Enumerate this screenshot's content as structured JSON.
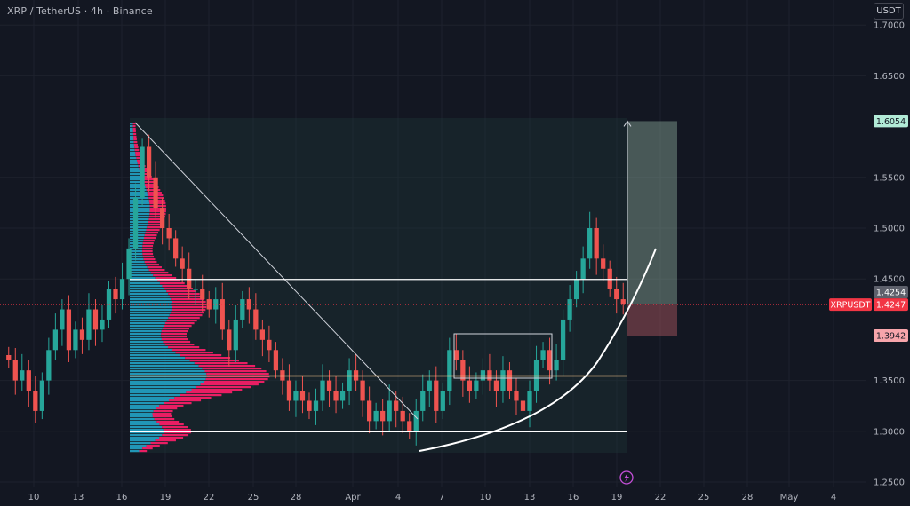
{
  "header": {
    "symbol_title": "XRP / TetherUS · 4h · Binance",
    "currency_button": "USDT"
  },
  "price_axis": {
    "ticks": [
      "1.7000",
      "1.6500",
      "1.6054",
      "1.5500",
      "1.5000",
      "1.4500",
      "1.4254",
      "1.4247",
      "1.3942",
      "1.3500",
      "1.3000",
      "1.2500"
    ],
    "tick_values": [
      1.7,
      1.65,
      1.55,
      1.5,
      1.45,
      1.35,
      1.3,
      1.25
    ],
    "tick_labels": [
      "1.7000",
      "1.6500",
      "1.5500",
      "1.5000",
      "1.4500",
      "1.3500",
      "1.3000",
      "1.2500"
    ]
  },
  "price_tags": {
    "target": {
      "label": "1.6054",
      "bg": "#b2ebd7",
      "fg": "#131722"
    },
    "last_close": {
      "label": "1.4254",
      "bg": "#5d606b",
      "fg": "#ffffff"
    },
    "symbol": {
      "label": "XRPUSDT",
      "bg": "#f23645",
      "fg": "#ffffff"
    },
    "current": {
      "label": "1.4247",
      "bg": "#f23645",
      "fg": "#ffffff"
    },
    "stop": {
      "label": "1.3942",
      "bg": "#f7a5ab",
      "fg": "#131722"
    }
  },
  "time_axis": {
    "labels": [
      "10",
      "13",
      "16",
      "19",
      "22",
      "25",
      "28",
      "Apr",
      "4",
      "7",
      "10",
      "13",
      "16",
      "19",
      "22",
      "25",
      "28",
      "May",
      "4"
    ]
  },
  "colors": {
    "background": "#131722",
    "up_candle": "#26a69a",
    "down_candle": "#ef5350",
    "volume_profile_up": "#2196b6",
    "volume_profile_down": "#e91e63",
    "grid": "#1e222d",
    "poc_line": "#f5c48a",
    "level_line": "#ffffff",
    "current_price_line": "#f23645"
  },
  "chart_data": {
    "type": "candlestick",
    "symbol": "XRPUSDT",
    "interval": "4h",
    "exchange": "Binance",
    "y_range": [
      1.245,
      1.72
    ],
    "current_price": 1.4247,
    "horizontal_levels": [
      1.4495,
      1.3545,
      1.2995
    ],
    "position": {
      "entry": 1.4247,
      "target": 1.6054,
      "stop": 1.3942
    },
    "close_path": [
      1.37,
      1.35,
      1.36,
      1.34,
      1.32,
      1.35,
      1.38,
      1.4,
      1.42,
      1.38,
      1.4,
      1.39,
      1.42,
      1.4,
      1.41,
      1.44,
      1.43,
      1.45,
      1.48,
      1.53,
      1.58,
      1.55,
      1.52,
      1.5,
      1.49,
      1.47,
      1.46,
      1.44,
      1.44,
      1.43,
      1.42,
      1.43,
      1.4,
      1.38,
      1.41,
      1.43,
      1.42,
      1.4,
      1.39,
      1.38,
      1.36,
      1.35,
      1.33,
      1.34,
      1.33,
      1.32,
      1.33,
      1.35,
      1.34,
      1.33,
      1.34,
      1.36,
      1.35,
      1.33,
      1.31,
      1.32,
      1.31,
      1.33,
      1.32,
      1.31,
      1.3,
      1.32,
      1.34,
      1.35,
      1.32,
      1.34,
      1.38,
      1.37,
      1.35,
      1.34,
      1.35,
      1.36,
      1.35,
      1.34,
      1.36,
      1.34,
      1.33,
      1.32,
      1.34,
      1.37,
      1.38,
      1.36,
      1.37,
      1.41,
      1.43,
      1.45,
      1.47,
      1.5,
      1.47,
      1.46,
      1.44,
      1.43,
      1.425
    ]
  }
}
